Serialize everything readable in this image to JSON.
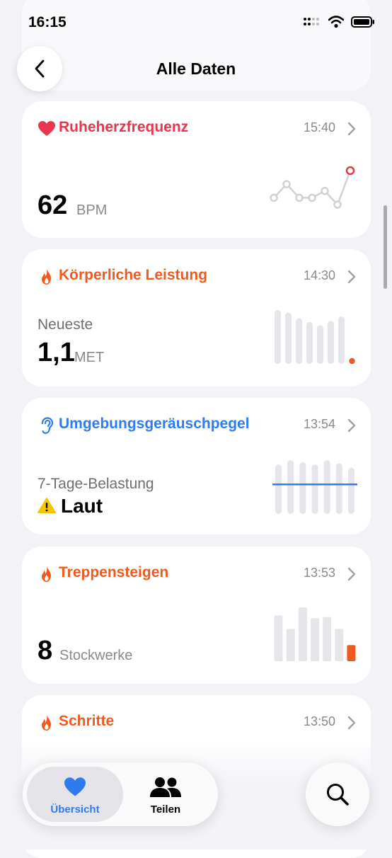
{
  "status": {
    "time": "16:15"
  },
  "nav": {
    "title": "Alle Daten"
  },
  "cards": [
    {
      "title": "Ruheherzfrequenz",
      "time": "15:40",
      "value": "62",
      "unit": "BPM",
      "icon": "heart-icon",
      "color": "#e8364f",
      "trend": [
        62,
        64,
        62,
        62,
        63,
        61,
        66
      ]
    },
    {
      "title": "Körperliche Leistung",
      "time": "14:30",
      "label": "Neueste",
      "value": "1,1",
      "unit": "MET",
      "icon": "flame-icon",
      "color": "#f05a1e",
      "bars": [
        1.0,
        0.95,
        0.85,
        0.78,
        0.72,
        0.8,
        0.88,
        0.1
      ]
    },
    {
      "title": "Umgebungsgeräuschpegel",
      "time": "13:54",
      "label": "7-Tage-Belastung",
      "value": "Laut",
      "icon": "ear-icon",
      "warning_icon": "warning-icon",
      "color": "#2e7cf0",
      "bars": [
        0.92,
        1.0,
        0.96,
        0.92,
        1.0,
        0.94,
        0.86
      ],
      "threshold_line": 0.55
    },
    {
      "title": "Treppensteigen",
      "time": "13:53",
      "value": "8",
      "unit": "Stockwerke",
      "icon": "flame-icon",
      "color": "#f05a1e",
      "bars": [
        0.85,
        0.6,
        1.0,
        0.8,
        0.82,
        0.6,
        0.3
      ]
    },
    {
      "title": "Schritte",
      "time": "13:50",
      "icon": "flame-icon",
      "color": "#f05a1e"
    }
  ],
  "tabs": [
    {
      "label": "Übersicht",
      "icon": "heart-icon",
      "active": true
    },
    {
      "label": "Teilen",
      "icon": "people-icon",
      "active": false
    }
  ],
  "search": {
    "icon": "search-icon"
  }
}
